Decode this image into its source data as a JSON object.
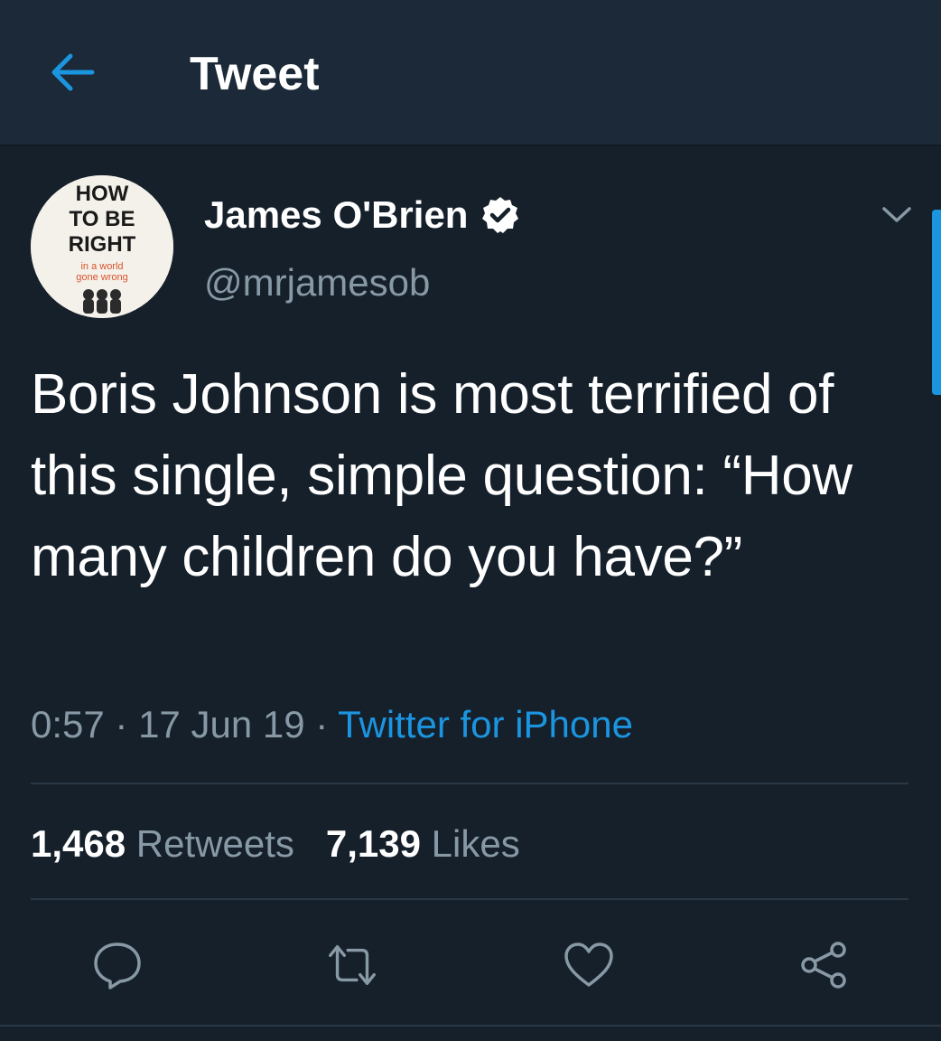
{
  "header": {
    "title": "Tweet",
    "back_icon": "arrow-left-icon"
  },
  "colors": {
    "background": "#15202b",
    "header_background": "#1c2938",
    "accent": "#1b95e0",
    "secondary_text": "#8899a6"
  },
  "tweet": {
    "author": {
      "name": "James O'Brien",
      "handle": "@mrjamesob",
      "verified": true,
      "avatar_text": {
        "line1": "HOW",
        "line2": "TO BE",
        "line3": "RIGHT",
        "line4": "in a world",
        "line5": "gone wrong"
      }
    },
    "text": "Boris Johnson is most terrified of this single, simple question: “How many children do you have?”",
    "time": "0:57",
    "separator": " · ",
    "date": "17 Jun 19",
    "source": "Twitter for iPhone",
    "stats": {
      "retweets_count": "1,468",
      "retweets_label": "Retweets",
      "likes_count": "7,139",
      "likes_label": "Likes"
    },
    "actions": {
      "reply_icon": "reply-icon",
      "retweet_icon": "retweet-icon",
      "like_icon": "heart-icon",
      "share_icon": "share-icon"
    }
  }
}
